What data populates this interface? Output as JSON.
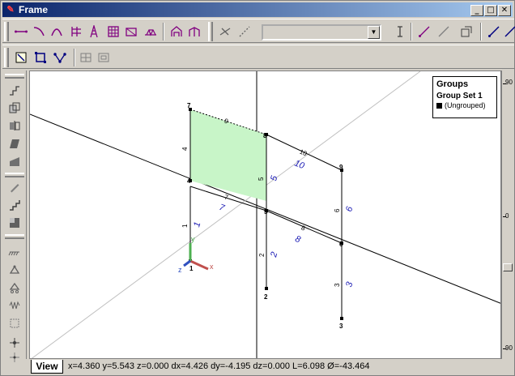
{
  "window": {
    "title": "Frame",
    "minimize": "_",
    "maximize": "□",
    "close": "✕"
  },
  "groups_panel": {
    "title": "Groups",
    "set_name": "Group Set 1",
    "item": "(Ungrouped)"
  },
  "status": {
    "tab": "View",
    "coords": "x=4.360 y=5.543 z=0.000 dx=4.426 dy=-4.195 dz=0.000 L=6.098 Ø=-43.464"
  },
  "ruler": {
    "labels": [
      "90",
      "0",
      "90"
    ]
  },
  "model": {
    "axis_labels": {
      "x": "x",
      "y": "y",
      "z": "z"
    },
    "node_labels": [
      "1",
      "2",
      "3",
      "4",
      "5",
      "6",
      "7",
      "8",
      "9"
    ],
    "member_labels_black": [
      "1",
      "2",
      "3",
      "4",
      "5",
      "6",
      "7",
      "8",
      "9",
      "10"
    ],
    "member_labels_blue": [
      "1",
      "2",
      "3",
      "5",
      "6",
      "7",
      "8",
      "10"
    ]
  },
  "colors": {
    "fill": "#c8f5c8",
    "axis_x": "#c0504d",
    "axis_y": "#4caf50",
    "axis_z": "#3050c0",
    "member_label": "#1a1ab4"
  }
}
